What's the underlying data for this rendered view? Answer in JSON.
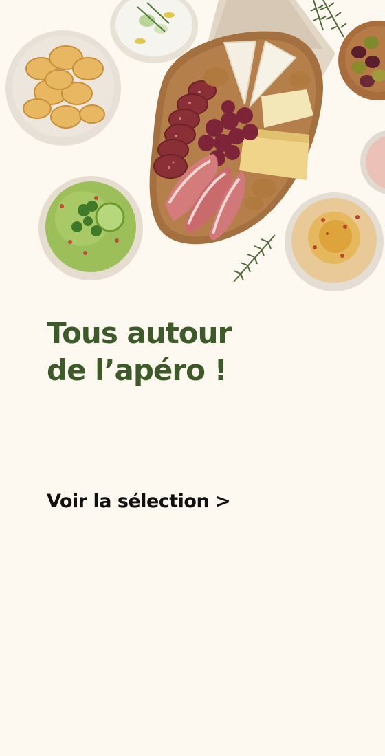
{
  "banner": {
    "headline_line1": "Tous autour",
    "headline_line2": "de l’apéro !",
    "cta_label": "Voir la sélection >"
  },
  "colors": {
    "background": "#fdf9f0",
    "headline": "#3e5a2a",
    "cta": "#111111"
  }
}
